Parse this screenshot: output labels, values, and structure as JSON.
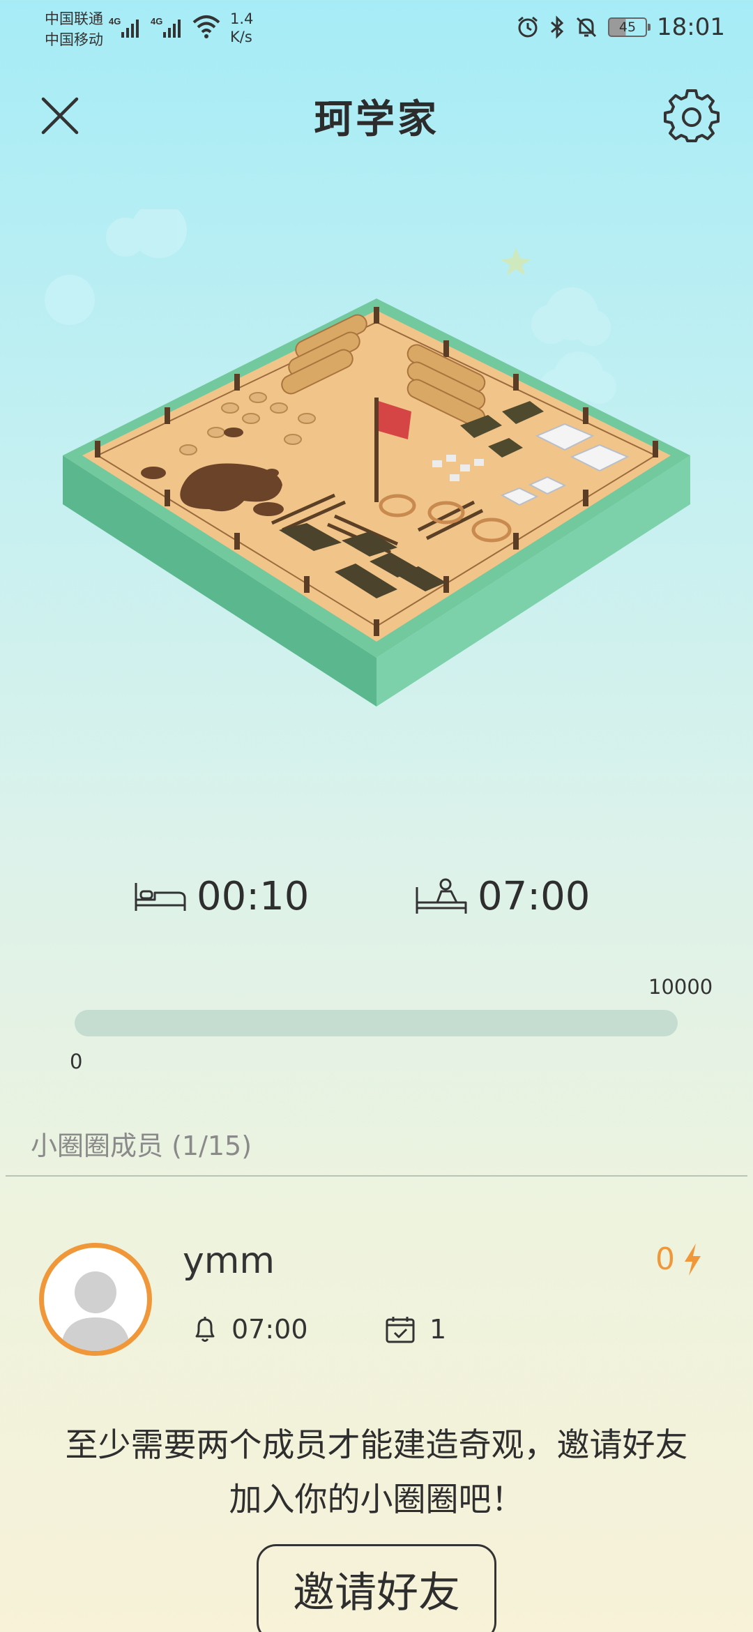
{
  "status_bar": {
    "carrier_1": "中国联通",
    "carrier_2": "中国移动",
    "net_type_1": "4G",
    "net_type_2": "4G",
    "net_speed_value": "1.4",
    "net_speed_unit": "K/s",
    "battery": "45",
    "time": "18:01",
    "icons": [
      "signal-icon",
      "wifi-icon",
      "alarm-clock-icon",
      "bluetooth-icon",
      "mute-icon",
      "battery-icon"
    ]
  },
  "header": {
    "title": "珂学家",
    "close_icon": "close-icon",
    "settings_icon": "gear-icon"
  },
  "scene": {
    "description_icon": "construction-site-illustration"
  },
  "sleep": {
    "bed_time": "00:10",
    "wake_time": "07:00",
    "bed_icon": "bed-icon",
    "wake_icon": "wake-up-icon"
  },
  "progress": {
    "min": "0",
    "max": "10000",
    "value": 0
  },
  "members_section": {
    "title": "小圈圈成员 (1/15)"
  },
  "member": {
    "name": "ymm",
    "energy": "0",
    "alarm_time": "07:00",
    "checkin_count": "1",
    "colors": {
      "accent": "#f0973a"
    }
  },
  "invite": {
    "message_line_1": "至少需要两个成员才能建造奇观，邀请好友",
    "message_line_2": "加入你的小圈圈吧！",
    "button_label": "邀请好友"
  }
}
